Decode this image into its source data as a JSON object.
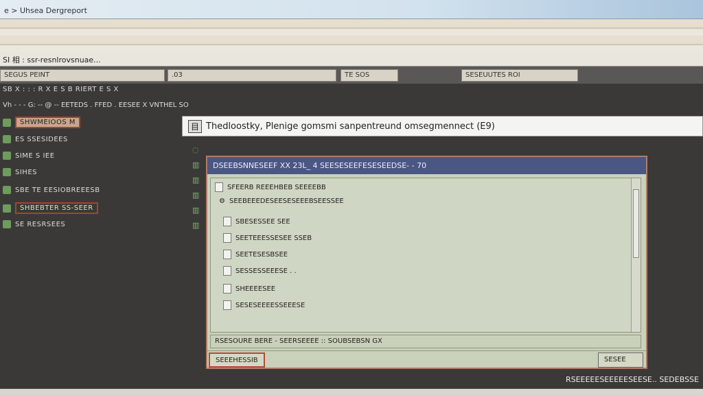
{
  "window": {
    "title": "e > Uhsea Dergreport"
  },
  "menubar": {
    "text": "SI 相 : ssr-resnlrovsnuae..."
  },
  "fields": {
    "left": "SEGUS PEINT",
    "middle": ".03",
    "tab1": "TE SOS",
    "tab2": "SESEUUTES ROI"
  },
  "sidebar": {
    "toolbar_text": "SB X : : : R X E S B RIERT E S X",
    "items": [
      "SHWMEIOOS M",
      "ES SSESIDEES",
      "SIME S IEE",
      "SIHES",
      "SBE TE EESIOBREEESB",
      "SHBEBTER SS-SEER",
      "SE RESRSEES"
    ]
  },
  "path": {
    "text": "Vh - - - G: -- @ -- EETEDS . FFED . EESEE X VNTHEL SO"
  },
  "address": {
    "icon": "目",
    "text": "Thedloostky, Plenige gomsmi sanpentreund omsegmennect (E9)"
  },
  "dialog": {
    "title": "DSEEBSNNESEEF XX 23L_ 4 SEESESEEFESESEEDSE- - 70",
    "items": [
      "SFEERB REEEHBEB SEEEEBB",
      "SEEBEEEDESEESESEEEBSEESSEE",
      "SBESESSEE SEE",
      "SEETEEESSESEE SSEB",
      "SEETESESBSEE",
      "SESSESSEEESE . .",
      "SHEEEESEE",
      "SESESEEEESSEEESE"
    ],
    "status": "RSESOURE BERE - SEERSEEEE :: SOUBSEBSN GX",
    "left_button": "SEEEHESSIB",
    "right_button": "SESEE"
  },
  "statusbar": {
    "text": "RSEEEEESEEEEESEESE.. SEDEBSSE"
  }
}
